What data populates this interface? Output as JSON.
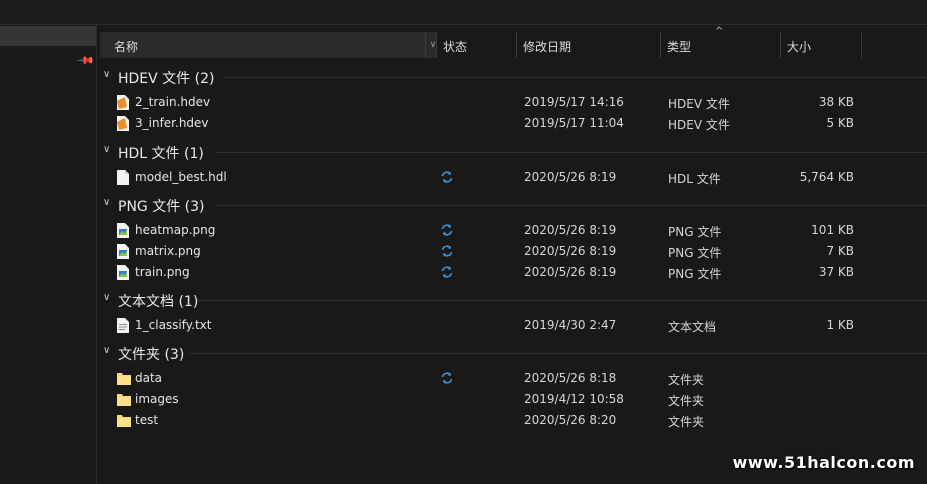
{
  "columns": {
    "name": "名称",
    "status": "状态",
    "modified": "修改日期",
    "type": "类型",
    "size": "大小"
  },
  "groups": [
    {
      "title": "HDEV 文件 (2)",
      "items": [
        {
          "name": "2_train.hdev",
          "icon": "hdev-file-icon",
          "status": "",
          "date": "2019/5/17 14:16",
          "type": "HDEV 文件",
          "size": "38 KB"
        },
        {
          "name": "3_infer.hdev",
          "icon": "hdev-file-icon",
          "status": "",
          "date": "2019/5/17 11:04",
          "type": "HDEV 文件",
          "size": "5 KB"
        }
      ]
    },
    {
      "title": "HDL 文件 (1)",
      "items": [
        {
          "name": "model_best.hdl",
          "icon": "blank-file-icon",
          "status": "sync-icon",
          "date": "2020/5/26 8:19",
          "type": "HDL 文件",
          "size": "5,764 KB"
        }
      ]
    },
    {
      "title": "PNG 文件 (3)",
      "items": [
        {
          "name": "heatmap.png",
          "icon": "image-file-icon",
          "status": "sync-icon",
          "date": "2020/5/26 8:19",
          "type": "PNG 文件",
          "size": "101 KB"
        },
        {
          "name": "matrix.png",
          "icon": "image-file-icon",
          "status": "sync-icon",
          "date": "2020/5/26 8:19",
          "type": "PNG 文件",
          "size": "7 KB"
        },
        {
          "name": "train.png",
          "icon": "image-file-icon",
          "status": "sync-icon",
          "date": "2020/5/26 8:19",
          "type": "PNG 文件",
          "size": "37 KB"
        }
      ]
    },
    {
      "title": "文本文档 (1)",
      "items": [
        {
          "name": "1_classify.txt",
          "icon": "text-file-icon",
          "status": "",
          "date": "2019/4/30 2:47",
          "type": "文本文档",
          "size": "1 KB"
        }
      ]
    },
    {
      "title": "文件夹 (3)",
      "items": [
        {
          "name": "data",
          "icon": "folder-icon",
          "status": "sync-icon",
          "date": "2020/5/26 8:18",
          "type": "文件夹",
          "size": ""
        },
        {
          "name": "images",
          "icon": "folder-icon",
          "status": "",
          "date": "2019/4/12 10:58",
          "type": "文件夹",
          "size": ""
        },
        {
          "name": "test",
          "icon": "folder-icon",
          "status": "",
          "date": "2020/5/26 8:20",
          "type": "文件夹",
          "size": ""
        }
      ]
    }
  ],
  "watermark": "www.51halcon.com",
  "colors": {
    "background": "#191919",
    "header_bg": "#2b2b2b",
    "sync_blue": "#3a96dd",
    "folder_yellow": "#f8d775",
    "hdev_orange": "#e8902c"
  }
}
